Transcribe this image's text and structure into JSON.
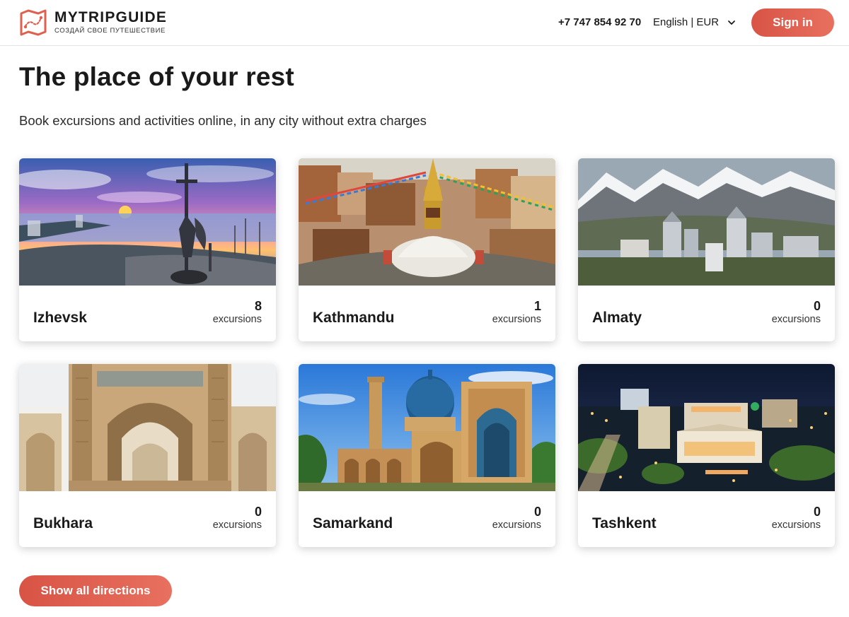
{
  "header": {
    "logo_title": "MYTRIPGUIDE",
    "logo_subtitle": "СОЗДАЙ СВОЕ ПУТЕШЕСТВИЕ",
    "phone": "+7 747 854 92 70",
    "language_currency": "English | EUR",
    "signin_label": "Sign in"
  },
  "hero": {
    "title": "The place of your rest",
    "subtitle": "Book excursions and activities online, in any city without extra charges"
  },
  "cities": [
    {
      "name": "Izhevsk",
      "count": "8",
      "count_label": "excursions"
    },
    {
      "name": "Kathmandu",
      "count": "1",
      "count_label": "excursions"
    },
    {
      "name": "Almaty",
      "count": "0",
      "count_label": "excursions"
    },
    {
      "name": "Bukhara",
      "count": "0",
      "count_label": "excursions"
    },
    {
      "name": "Samarkand",
      "count": "0",
      "count_label": "excursions"
    },
    {
      "name": "Tashkent",
      "count": "0",
      "count_label": "excursions"
    }
  ],
  "show_all_label": "Show all directions",
  "colors": {
    "accent": "#e0604f",
    "text": "#1a1a1a"
  }
}
